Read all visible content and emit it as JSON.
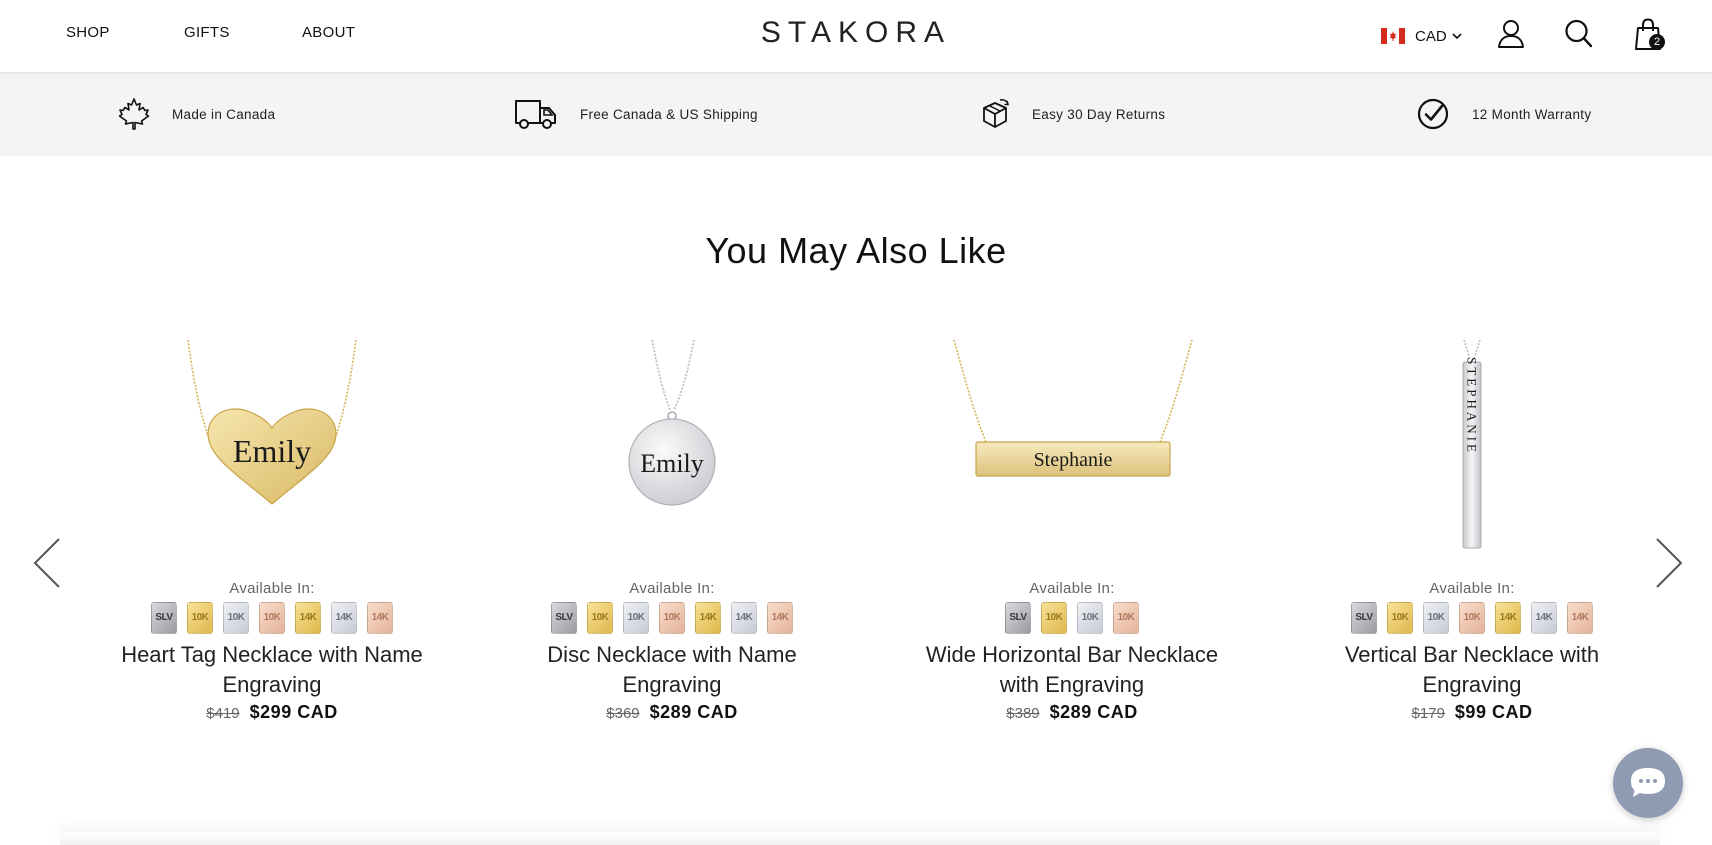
{
  "nav": {
    "shop": "SHOP",
    "gifts": "GIFTS",
    "about": "ABOUT"
  },
  "brand": {
    "logo": "STAKORA"
  },
  "currency": {
    "label": "CAD",
    "flag": "canada-flag"
  },
  "cart": {
    "count": "2"
  },
  "usps": [
    {
      "icon": "maple-leaf-icon",
      "text": "Made in Canada"
    },
    {
      "icon": "truck-icon",
      "text": "Free Canada & US Shipping"
    },
    {
      "icon": "box-return-icon",
      "text": "Easy 30 Day Returns"
    },
    {
      "icon": "check-circle-icon",
      "text": "12 Month Warranty"
    }
  ],
  "section": {
    "title": "You May Also Like"
  },
  "products": [
    {
      "title_line1": "Heart Tag Necklace with Name",
      "title_line2": "Engraving",
      "available_label": "Available In:",
      "swatches": [
        "SLV",
        "10K",
        "10K",
        "10K",
        "14K",
        "14K",
        "14K"
      ],
      "old_price": "$419",
      "price": "$299 CAD",
      "engraving": "Emily"
    },
    {
      "title_line1": "Disc Necklace with Name",
      "title_line2": "Engraving",
      "available_label": "Available In:",
      "swatches": [
        "SLV",
        "10K",
        "10K",
        "10K",
        "14K",
        "14K",
        "14K"
      ],
      "old_price": "$369",
      "price": "$289 CAD",
      "engraving": "Emily"
    },
    {
      "title_line1": "Wide Horizontal Bar Necklace",
      "title_line2": "with Engraving",
      "available_label": "Available In:",
      "swatches": [
        "SLV",
        "10K",
        "10K",
        "10K"
      ],
      "old_price": "$389",
      "price": "$289 CAD",
      "engraving": "Stephanie"
    },
    {
      "title_line1": "Vertical Bar Necklace with",
      "title_line2": "Engraving",
      "available_label": "Available In:",
      "swatches": [
        "SLV",
        "10K",
        "10K",
        "10K",
        "14K",
        "14K",
        "14K"
      ],
      "old_price": "$179",
      "price": "$99 CAD",
      "engraving": "STEPHANIE"
    }
  ],
  "colors": {
    "usp_bar_bg": "#f4f4f4",
    "chat_button": "#8e9bb2",
    "gold": "#e7c66b",
    "silver": "#c8cacf"
  }
}
